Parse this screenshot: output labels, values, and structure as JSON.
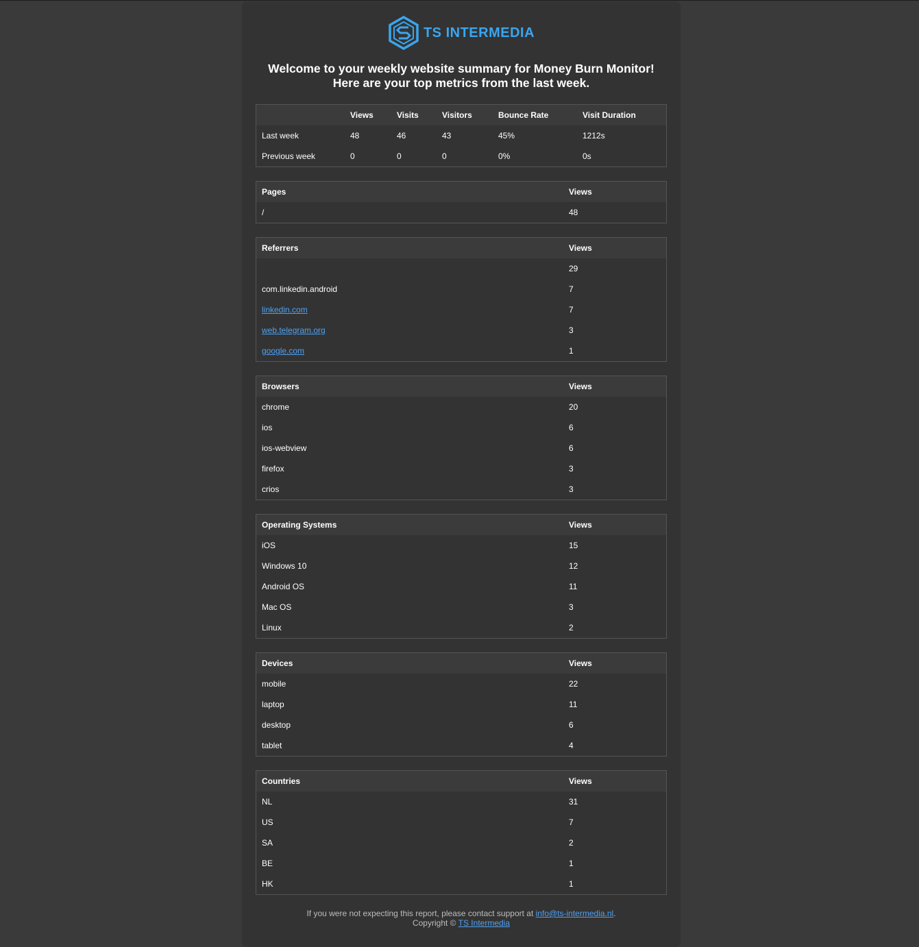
{
  "brand": {
    "name": "TS INTERMEDIA",
    "color": "#3aa6f0",
    "icon": "ts-hexagon-logo"
  },
  "heading": {
    "line1": "Welcome to your weekly website summary for Money Burn Monitor!",
    "line2": "Here are your top metrics from the last week."
  },
  "summary": {
    "headers": [
      "",
      "Views",
      "Visits",
      "Visitors",
      "Bounce Rate",
      "Visit Duration"
    ],
    "rows": [
      [
        "Last week",
        "48",
        "46",
        "43",
        "45%",
        "1212s"
      ],
      [
        "Previous week",
        "0",
        "0",
        "0",
        "0%",
        "0s"
      ]
    ]
  },
  "pages": {
    "title": "Pages",
    "col": "Views",
    "rows": [
      [
        "/",
        "48"
      ]
    ]
  },
  "referrers": {
    "title": "Referrers",
    "col": "Views",
    "rows": [
      [
        "",
        "29"
      ],
      [
        "com.linkedin.android",
        "7"
      ],
      [
        "linkedin.com",
        "7"
      ],
      [
        "web.telegram.org",
        "3"
      ],
      [
        "google.com",
        "1"
      ]
    ]
  },
  "browsers": {
    "title": "Browsers",
    "col": "Views",
    "rows": [
      [
        "chrome",
        "20"
      ],
      [
        "ios",
        "6"
      ],
      [
        "ios-webview",
        "6"
      ],
      [
        "firefox",
        "3"
      ],
      [
        "crios",
        "3"
      ]
    ]
  },
  "os": {
    "title": "Operating Systems",
    "col": "Views",
    "rows": [
      [
        "iOS",
        "15"
      ],
      [
        "Windows 10",
        "12"
      ],
      [
        "Android OS",
        "11"
      ],
      [
        "Mac OS",
        "3"
      ],
      [
        "Linux",
        "2"
      ]
    ]
  },
  "devices": {
    "title": "Devices",
    "col": "Views",
    "rows": [
      [
        "mobile",
        "22"
      ],
      [
        "laptop",
        "11"
      ],
      [
        "desktop",
        "6"
      ],
      [
        "tablet",
        "4"
      ]
    ]
  },
  "countries": {
    "title": "Countries",
    "col": "Views",
    "rows": [
      [
        "NL",
        "31"
      ],
      [
        "US",
        "7"
      ],
      [
        "SA",
        "2"
      ],
      [
        "BE",
        "1"
      ],
      [
        "HK",
        "1"
      ]
    ]
  },
  "footer": {
    "text1": "If you were not expecting this report, please contact support at",
    "email": "info@ts-intermedia.nl",
    "text2": "Copyright ©",
    "link": "TS Intermedia"
  }
}
